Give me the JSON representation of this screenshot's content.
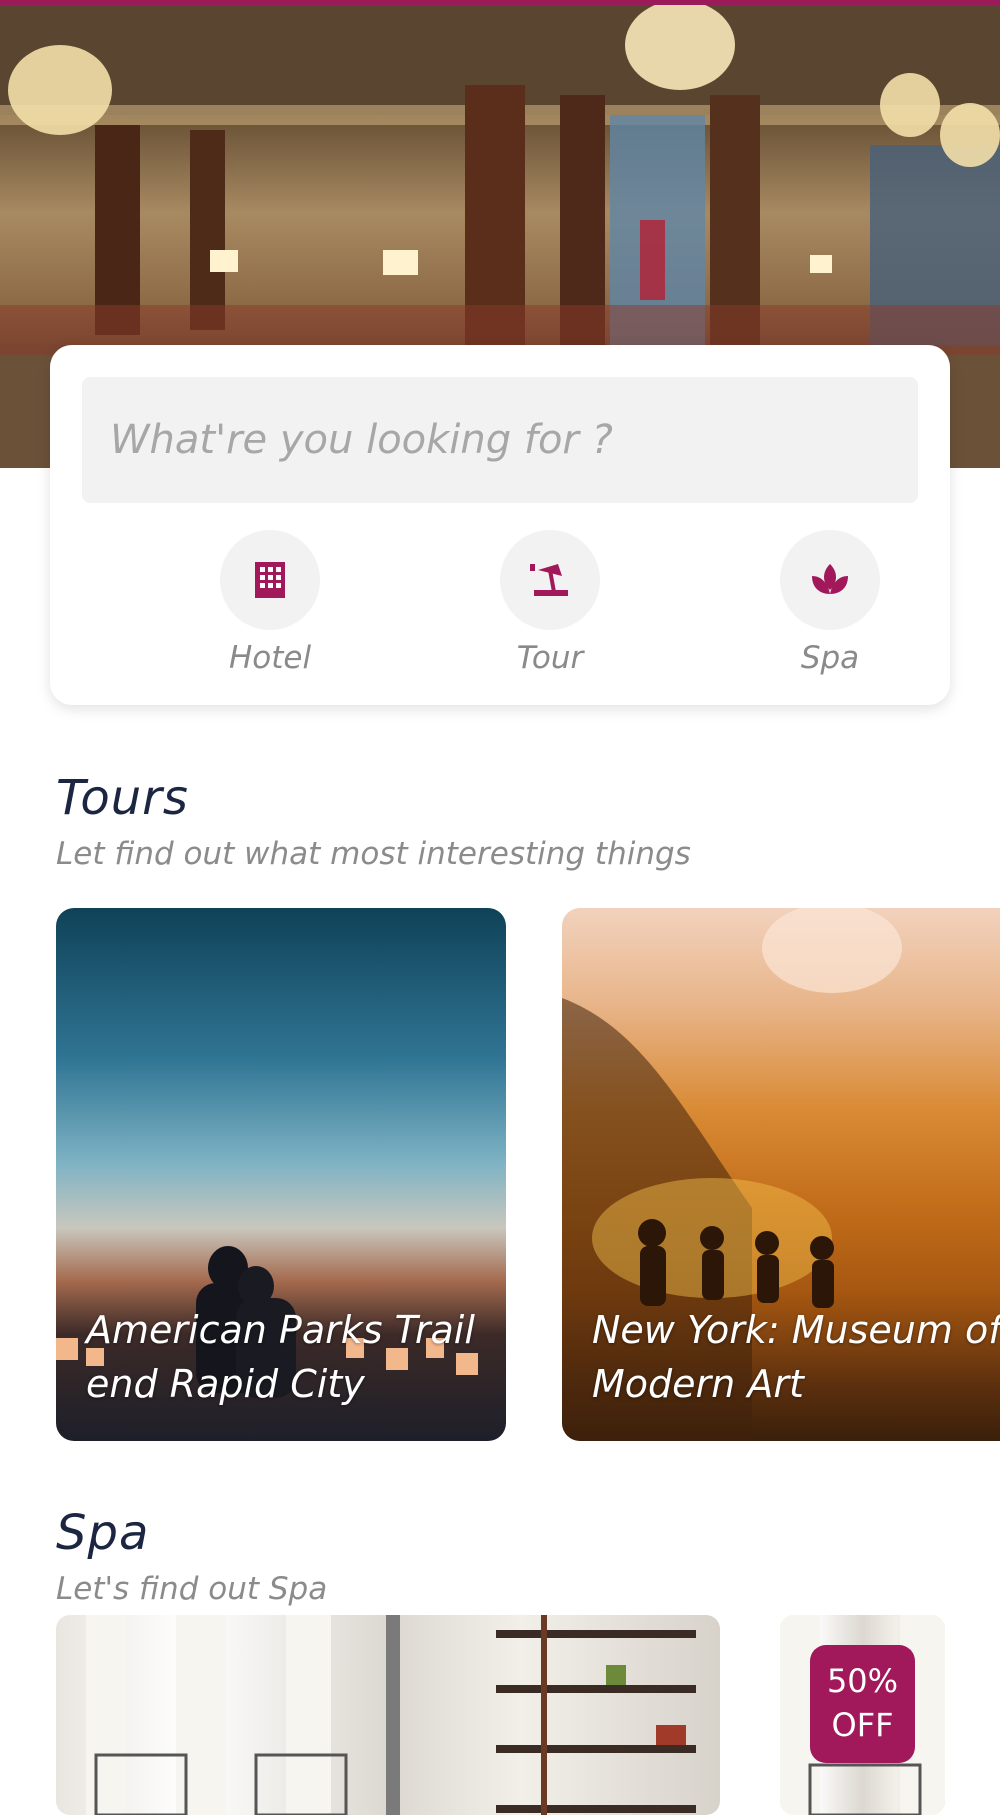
{
  "search": {
    "placeholder": "What're you looking for ?"
  },
  "categories": [
    {
      "label": "Hotel",
      "icon": "building-icon"
    },
    {
      "label": "Tour",
      "icon": "beach-umbrella-icon"
    },
    {
      "label": "Spa",
      "icon": "lotus-icon"
    }
  ],
  "tours": {
    "title": "Tours",
    "subtitle": "Let find out what most interesting things",
    "items": [
      {
        "title": "American Parks Trail end Rapid City"
      },
      {
        "title": "New York: Museum of Modern Art"
      }
    ]
  },
  "spa": {
    "title": "Spa",
    "subtitle": "Let's find out Spa",
    "badge": {
      "line1": "50%",
      "line2": "OFF"
    }
  },
  "colors": {
    "accent": "#a1195a",
    "heading": "#1c2541",
    "muted": "#8b8b8b"
  }
}
